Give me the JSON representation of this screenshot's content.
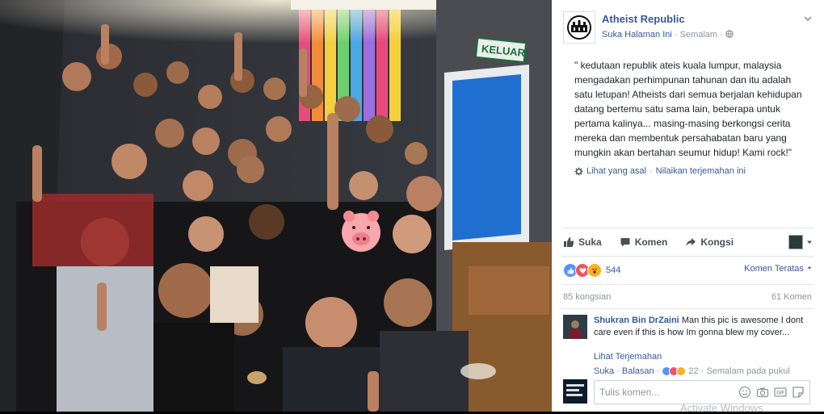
{
  "post": {
    "page_name": "Atheist Republic",
    "like_page": "Suka Halaman Ini",
    "time": "Semalam",
    "text": "\" kedutaan republik ateis kuala lumpur, malaysia mengadakan perhimpunan tahunan dan itu adalah satu letupan! Atheists dari semua berjalan kehidupan datang bertemu satu sama lain, beberapa untuk pertama kalinya... masing-masing berkongsi cerita mereka dan membentuk persahabatan baru yang mungkin akan bertahan seumur hidup! Kami rock!\"",
    "see_original": "Lihat yang asal",
    "rate_translation": "Nilaikan terjemahan ini"
  },
  "photo": {
    "exit_sign": "KELUAR",
    "description_icon": "group-selfie-photo"
  },
  "actions": {
    "like": "Suka",
    "comment": "Komen",
    "share": "Kongsi"
  },
  "reactions": {
    "count": "544",
    "sort": "Komen Teratas"
  },
  "counts": {
    "shares": "85 kongsian",
    "comments": "61 Komen"
  },
  "comment": {
    "author": "Shukran Bin DrZaini",
    "text": "Man this pic is awesome I dont care even if this is how Im gonna blew my cover...",
    "see_translation": "Lihat Terjemahan",
    "like": "Suka",
    "reply": "Balasan",
    "reaction_count": "22",
    "time": "Semalam pada pukul"
  },
  "composer": {
    "placeholder": "Tulis komen..."
  },
  "overlay": {
    "watermark": "Activate Windows"
  },
  "colors": {
    "link": "#365899",
    "like_blue": "#5890ff",
    "love_red": "#f25268",
    "wow_yellow": "#f7b125"
  }
}
